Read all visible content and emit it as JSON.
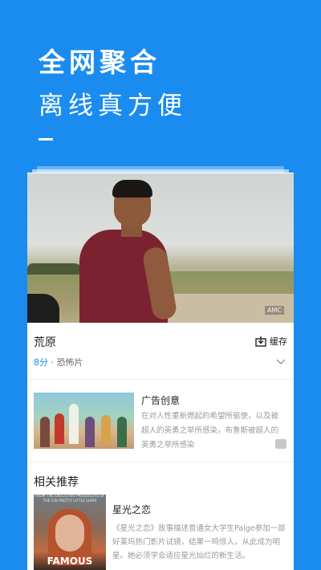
{
  "hero": {
    "line1": "全网聚合",
    "line2": "离线真方便"
  },
  "movie": {
    "title": "荒原",
    "download_label": "缓存",
    "score": "8分",
    "separator": " · ",
    "genre": "恐怖片",
    "watermark": "AMC"
  },
  "ad": {
    "title": "广告创意",
    "description": "在对人性重新燃起的希望所驱使，以及被超人的英勇之举所感染，布鲁斯被超人的英勇之举所感染"
  },
  "recommend": {
    "section_title": "相关推荐",
    "items": [
      {
        "title": "星光之恋",
        "description": "《星光之恋》故事描述普通女大学生Paige参加一部好莱坞热门影片试镜，结果一鸣惊人，从此成为明星。她必须学会适应星光灿烂的新生活。",
        "poster_top": "FROM THE EXECUTIVE PRODUCERS OF THE CW PRETTY LITTLE LIARS",
        "poster_title": "FAMOUS"
      }
    ]
  },
  "colors": {
    "brand": "#1a8cf0",
    "score": "#1a8cf0"
  }
}
